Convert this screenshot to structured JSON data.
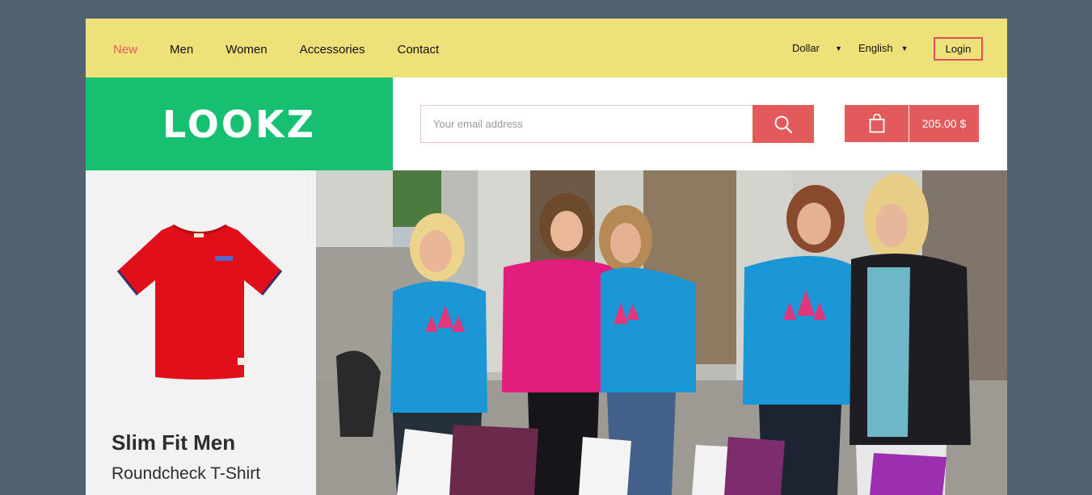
{
  "nav": {
    "items": [
      {
        "label": "New",
        "active": true
      },
      {
        "label": "Men",
        "active": false
      },
      {
        "label": "Women",
        "active": false
      },
      {
        "label": "Accessories",
        "active": false
      },
      {
        "label": "Contact",
        "active": false
      }
    ],
    "currency": "Dollar",
    "language": "English",
    "login_label": "Login"
  },
  "brand": {
    "logo_text": "LOOKZ"
  },
  "search": {
    "placeholder": "Your email address",
    "button_icon": "search-icon"
  },
  "cart": {
    "icon": "shopping-bag-icon",
    "total": "205.00 $"
  },
  "product": {
    "title": "Slim Fit Men",
    "subtitle": "Roundcheck T-Shirt",
    "image": "red-tshirt"
  },
  "hero": {
    "image": "group-of-girls-shopping-photo"
  },
  "colors": {
    "background": "#536271",
    "topbar": "#eee17a",
    "brand_green": "#17c070",
    "accent_red": "#e25b5a",
    "active_nav": "#e35a5a",
    "panel_gray": "#f2f2f2"
  }
}
